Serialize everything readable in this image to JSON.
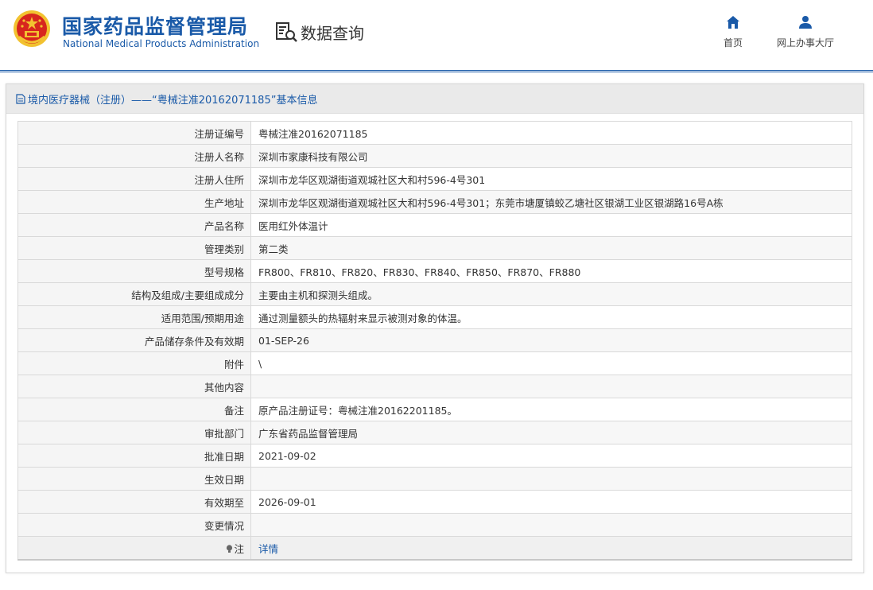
{
  "header": {
    "org_cn": "国家药品监督管理局",
    "org_en": "National Medical Products Administration",
    "query_label": "数据查询",
    "nav": [
      {
        "label": "首页",
        "icon": "home-icon"
      },
      {
        "label": "网上办事大厅",
        "icon": "user-icon"
      }
    ]
  },
  "panel": {
    "title": "境内医疗器械（注册）——“粤械注准20162071185”基本信息"
  },
  "rows": [
    {
      "key": "注册证编号",
      "value": "粤械注准20162071185"
    },
    {
      "key": "注册人名称",
      "value": "深圳市家康科技有限公司"
    },
    {
      "key": "注册人住所",
      "value": "深圳市龙华区观湖街道观城社区大和村596-4号301"
    },
    {
      "key": "生产地址",
      "value": "深圳市龙华区观湖街道观城社区大和村596-4号301；东莞市塘厦镇蛟乙塘社区银湖工业区银湖路16号A栋"
    },
    {
      "key": "产品名称",
      "value": "医用红外体温计"
    },
    {
      "key": "管理类别",
      "value": "第二类"
    },
    {
      "key": "型号规格",
      "value": "FR800、FR810、FR820、FR830、FR840、FR850、FR870、FR880"
    },
    {
      "key": "结构及组成/主要组成成分",
      "value": "主要由主机和探测头组成。"
    },
    {
      "key": "适用范围/预期用途",
      "value": "通过测量额头的热辐射来显示被测对象的体温。"
    },
    {
      "key": "产品储存条件及有效期",
      "value": "01-SEP-26"
    },
    {
      "key": "附件",
      "value": "\\"
    },
    {
      "key": "其他内容",
      "value": ""
    },
    {
      "key": "备注",
      "value": "原产品注册证号：粤械注准20162201185。"
    },
    {
      "key": "审批部门",
      "value": "广东省药品监督管理局"
    },
    {
      "key": "批准日期",
      "value": "2021-09-02"
    },
    {
      "key": "生效日期",
      "value": ""
    },
    {
      "key": "有效期至",
      "value": "2026-09-01"
    },
    {
      "key": "变更情况",
      "value": ""
    }
  ],
  "note": {
    "key": "注",
    "link": "详情"
  },
  "colors": {
    "brand": "#1a5aa8",
    "logo_red": "#d7261e",
    "logo_gold": "#f2c230"
  }
}
